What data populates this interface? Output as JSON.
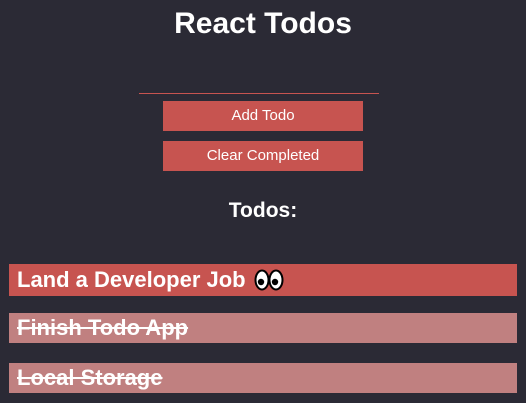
{
  "header": {
    "title": "React Todos"
  },
  "form": {
    "input_value": "",
    "input_placeholder": "",
    "add_label": "Add Todo",
    "clear_label": "Clear Completed"
  },
  "list": {
    "heading": "Todos:",
    "items": [
      {
        "text": "Land a Developer Job",
        "completed": false,
        "icon": "eyes-icon"
      },
      {
        "text": "Finish Todo App",
        "completed": true
      },
      {
        "text": "Local Storage",
        "completed": true
      }
    ]
  },
  "colors": {
    "background": "#2b2a35",
    "accent": "#c75450",
    "completed": "#c08080",
    "text": "#ffffff"
  }
}
